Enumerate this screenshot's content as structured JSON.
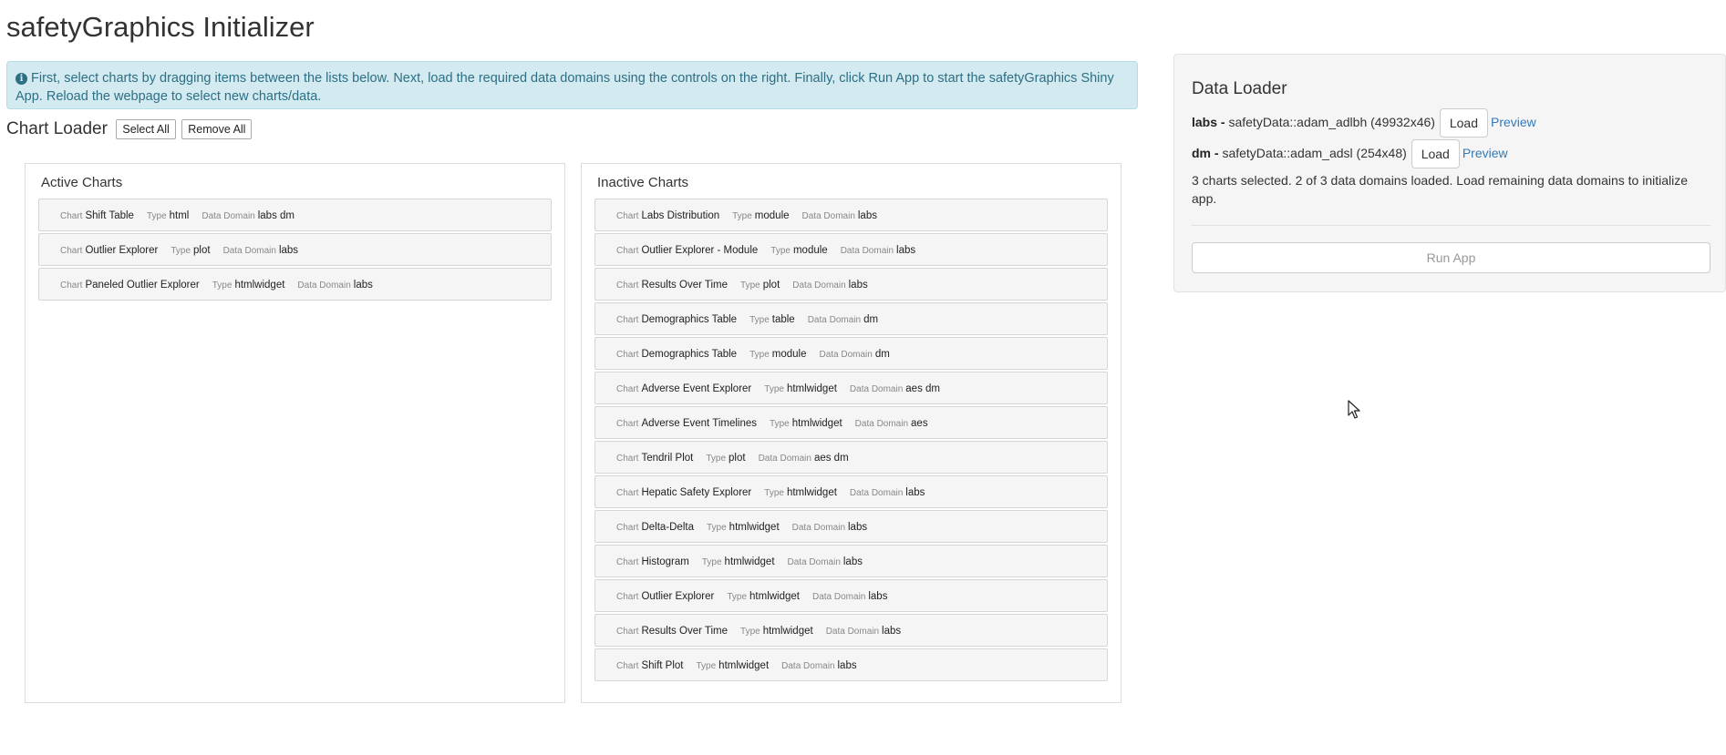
{
  "page": {
    "title": "safetyGraphics Initializer"
  },
  "info_alert": {
    "icon": "info-circle-icon",
    "text": "First, select charts by dragging items between the lists below. Next, load the required data domains using the controls on the right. Finally, click Run App to start the safetyGraphics Shiny App. Reload the webpage to select new charts/data."
  },
  "chart_loader": {
    "title": "Chart Loader",
    "select_all_label": "Select All",
    "remove_all_label": "Remove All"
  },
  "field_labels": {
    "chart": "Chart",
    "type": "Type",
    "domain": "Data Domain"
  },
  "active_charts": {
    "title": "Active Charts",
    "items": [
      {
        "chart": "Shift Table",
        "type": "html",
        "domain": "labs dm"
      },
      {
        "chart": "Outlier Explorer",
        "type": "plot",
        "domain": "labs"
      },
      {
        "chart": "Paneled Outlier Explorer",
        "type": "htmlwidget",
        "domain": "labs"
      }
    ]
  },
  "inactive_charts": {
    "title": "Inactive Charts",
    "items": [
      {
        "chart": "Labs Distribution",
        "type": "module",
        "domain": "labs"
      },
      {
        "chart": "Outlier Explorer - Module",
        "type": "module",
        "domain": "labs"
      },
      {
        "chart": "Results Over Time",
        "type": "plot",
        "domain": "labs"
      },
      {
        "chart": "Demographics Table",
        "type": "table",
        "domain": "dm"
      },
      {
        "chart": "Demographics Table",
        "type": "module",
        "domain": "dm"
      },
      {
        "chart": "Adverse Event Explorer",
        "type": "htmlwidget",
        "domain": "aes dm"
      },
      {
        "chart": "Adverse Event Timelines",
        "type": "htmlwidget",
        "domain": "aes"
      },
      {
        "chart": "Tendril Plot",
        "type": "plot",
        "domain": "aes dm"
      },
      {
        "chart": "Hepatic Safety Explorer",
        "type": "htmlwidget",
        "domain": "labs"
      },
      {
        "chart": "Delta-Delta",
        "type": "htmlwidget",
        "domain": "labs"
      },
      {
        "chart": "Histogram",
        "type": "htmlwidget",
        "domain": "labs"
      },
      {
        "chart": "Outlier Explorer",
        "type": "htmlwidget",
        "domain": "labs"
      },
      {
        "chart": "Results Over Time",
        "type": "htmlwidget",
        "domain": "labs"
      },
      {
        "chart": "Shift Plot",
        "type": "htmlwidget",
        "domain": "labs"
      }
    ]
  },
  "data_loader": {
    "title": "Data Loader",
    "domains": [
      {
        "name": "labs -",
        "source": "safetyData::adam_adlbh (49932x46)",
        "load_label": "Load",
        "preview_label": "Preview"
      },
      {
        "name": "dm -",
        "source": "safetyData::adam_adsl (254x48)",
        "load_label": "Load",
        "preview_label": "Preview"
      }
    ],
    "status": "3 charts selected. 2 of 3 data domains loaded. Load remaining data domains to initialize app.",
    "run_label": "Run App"
  },
  "colors": {
    "info_bg": "#d3eaf0",
    "info_text": "#2d6f85",
    "link": "#337ab7",
    "panel_bg": "#f5f5f5"
  }
}
